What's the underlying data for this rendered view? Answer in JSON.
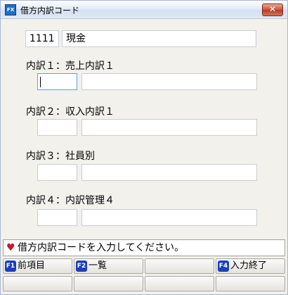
{
  "window": {
    "title": "借方内訳コード",
    "close_glyph": "✕",
    "app_icon_text": "FX"
  },
  "account": {
    "code": "1111",
    "name": "現金"
  },
  "rows": [
    {
      "label": "内訳１：売上内訳１",
      "code": "",
      "name": ""
    },
    {
      "label": "内訳２：収入内訳１",
      "code": "",
      "name": ""
    },
    {
      "label": "内訳３：社員別",
      "code": "",
      "name": ""
    },
    {
      "label": "内訳４：内訳管理４",
      "code": "",
      "name": ""
    }
  ],
  "status": {
    "message": "借方内訳コードを入力してください。",
    "icon": "heart-icon"
  },
  "fkeys": {
    "f1": {
      "badge": "F1",
      "label": "前項目"
    },
    "f2": {
      "badge": "F2",
      "label": "一覧"
    },
    "f4": {
      "badge": "F4",
      "label": "入力終了"
    }
  },
  "colors": {
    "badge": "#1b3fbd",
    "heart": "#d4102a",
    "focus_border": "#6d9cd8"
  }
}
